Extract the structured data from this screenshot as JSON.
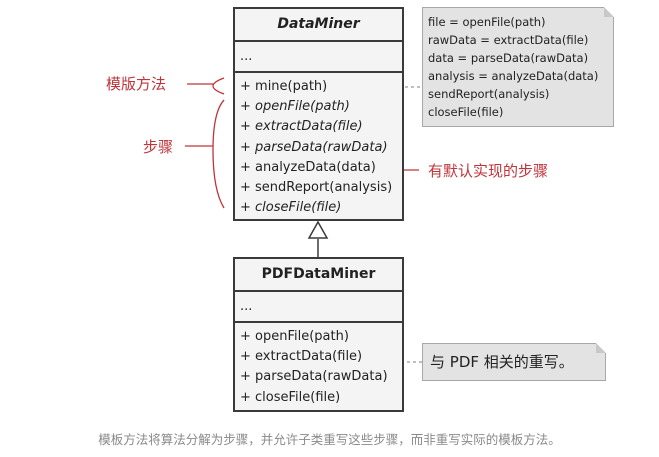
{
  "base_class": {
    "name": "DataMiner",
    "attributes": "...",
    "operations": [
      {
        "text": "+ mine(path)",
        "italic": false
      },
      {
        "text": "+ openFile(path)",
        "italic": true
      },
      {
        "text": "+ extractData(file)",
        "italic": true
      },
      {
        "text": "+ parseData(rawData)",
        "italic": true
      },
      {
        "text": "+ analyzeData(data)",
        "italic": false
      },
      {
        "text": "+ sendReport(analysis)",
        "italic": false
      },
      {
        "text": "+ closeFile(file)",
        "italic": true
      }
    ]
  },
  "sub_class": {
    "name": "PDFDataMiner",
    "attributes": "...",
    "operations": [
      {
        "text": "+ openFile(path)"
      },
      {
        "text": "+ extractData(file)"
      },
      {
        "text": "+ parseData(rawData)"
      },
      {
        "text": "+ closeFile(file)"
      }
    ]
  },
  "code_note": {
    "lines": [
      "file = openFile(path)",
      "rawData = extractData(file)",
      "data = parseData(rawData)",
      "analysis = analyzeData(data)",
      "sendReport(analysis)",
      "closeFile(file)"
    ]
  },
  "override_note": {
    "text": "与 PDF 相关的重写。"
  },
  "labels": {
    "template_method": "模版方法",
    "steps": "步骤",
    "default_steps": "有默认实现的步骤"
  },
  "caption": "模板方法将算法分解为步骤，并允许子类重写这些步骤，而非重写实际的模板方法。",
  "colors": {
    "accent_red": "#c0343a",
    "box_fill": "#f4f4f4",
    "note_fill": "#e3e3e3"
  }
}
